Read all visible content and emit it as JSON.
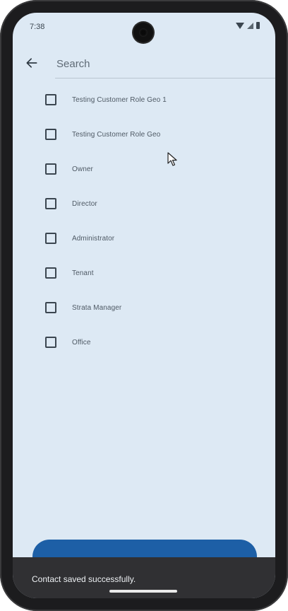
{
  "status_bar": {
    "time": "7:38"
  },
  "search": {
    "placeholder": "Search",
    "value": ""
  },
  "roles": [
    {
      "label": "Testing Customer Role Geo 1",
      "checked": false
    },
    {
      "label": "Testing Customer Role Geo",
      "checked": false
    },
    {
      "label": "Owner",
      "checked": false
    },
    {
      "label": "Director",
      "checked": false
    },
    {
      "label": "Administrator",
      "checked": false
    },
    {
      "label": "Tenant",
      "checked": false
    },
    {
      "label": "Strata Manager",
      "checked": false
    },
    {
      "label": "Office",
      "checked": false
    }
  ],
  "snackbar": {
    "message": "Contact saved successfully."
  },
  "colors": {
    "screen_background": "#dde9f4",
    "primary_button": "#1d5fa6",
    "snackbar_background": "#303033",
    "text": "#3b4650"
  },
  "icons": {
    "back": "arrow-left-icon",
    "wifi": "wifi-icon",
    "signal": "cellular-signal-icon",
    "battery": "battery-icon"
  }
}
